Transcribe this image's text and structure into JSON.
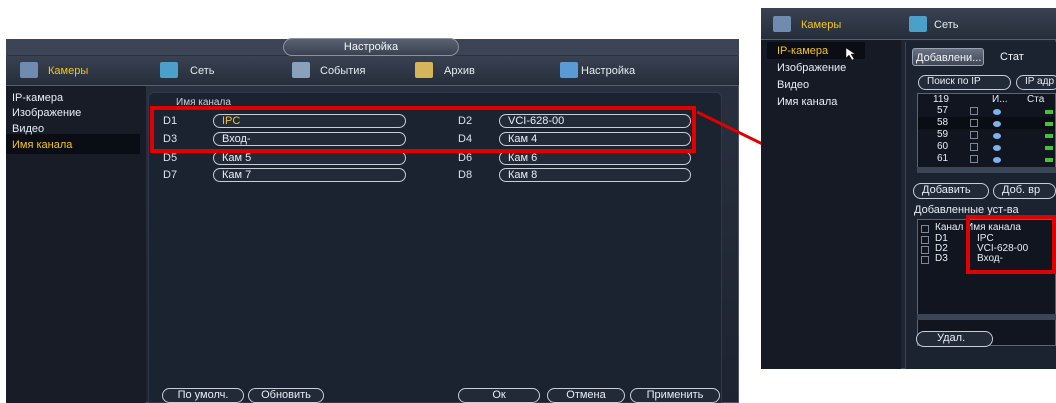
{
  "left": {
    "window_title": "Настройка",
    "menu": [
      {
        "label": "Камеры",
        "icon": "camera-icon",
        "active": true
      },
      {
        "label": "Сеть",
        "icon": "network-icon"
      },
      {
        "label": "События",
        "icon": "events-icon"
      },
      {
        "label": "Архив",
        "icon": "archive-icon"
      },
      {
        "label": "Настройка",
        "icon": "settings-icon"
      }
    ],
    "sidebar": [
      "IP-камера",
      "Изображение",
      "Видео",
      "Имя канала"
    ],
    "sidebar_selected": "Имя канала",
    "section_title": "Имя канала",
    "channels": [
      {
        "id": "D1",
        "name": "IPC"
      },
      {
        "id": "D2",
        "name": "VCI-628-00"
      },
      {
        "id": "D3",
        "name": "Вход-"
      },
      {
        "id": "D4",
        "name": "Кам 4"
      },
      {
        "id": "D5",
        "name": "Кам 5"
      },
      {
        "id": "D6",
        "name": "Кам 6"
      },
      {
        "id": "D7",
        "name": "Кам 7"
      },
      {
        "id": "D8",
        "name": "Кам 8"
      }
    ],
    "buttons": {
      "default": "По умолч.",
      "refresh": "Обновить",
      "ok": "Ок",
      "cancel": "Отмена",
      "apply": "Применить"
    }
  },
  "right": {
    "menu": [
      {
        "label": "Камеры",
        "icon": "camera-icon",
        "active": true
      },
      {
        "label": "Сеть",
        "icon": "network-icon"
      }
    ],
    "sidebar": [
      "IP-камера",
      "Изображение",
      "Видео",
      "Имя канала"
    ],
    "sidebar_selected": "IP-камера",
    "tabs": [
      "Добавлени...",
      "Стат"
    ],
    "search_buttons": [
      "Поиск по IP",
      "IP адр"
    ],
    "device_count": "119",
    "list_headers": [
      "И...",
      "Ста"
    ],
    "device_rows": [
      "57",
      "58",
      "59",
      "60",
      "61"
    ],
    "add_buttons": [
      "Добавить",
      "Доб. вр"
    ],
    "added_title": "Добавленные уст-ва",
    "added_headers": [
      "Канал",
      "Имя канала"
    ],
    "added_rows": [
      {
        "id": "D1",
        "name": "IPC"
      },
      {
        "id": "D2",
        "name": "VCI-628-00"
      },
      {
        "id": "D3",
        "name": "Вход-"
      }
    ],
    "delete_button": "Удал."
  },
  "colors": {
    "highlight": "#e00000",
    "accent": "#f3c51b",
    "status_green": "#46c23a"
  }
}
